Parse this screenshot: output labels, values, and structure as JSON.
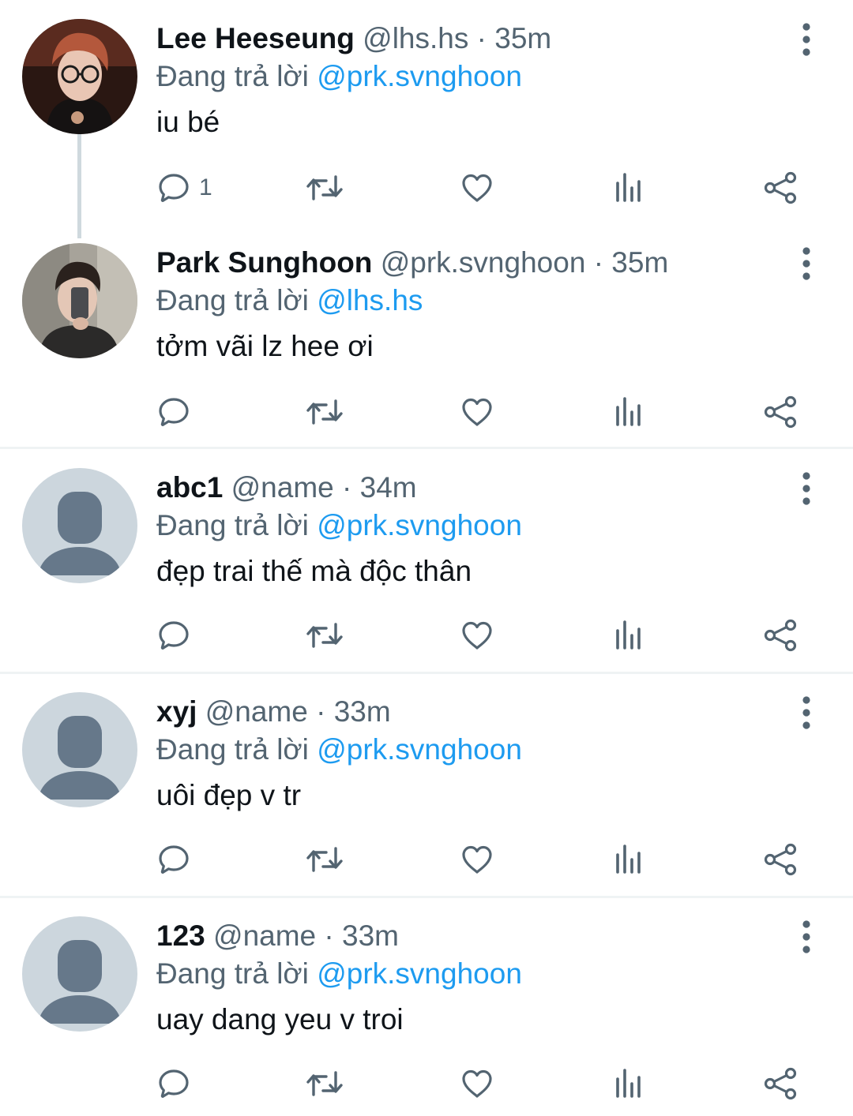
{
  "reply_prefix": "Đang trả lời",
  "colors": {
    "text": "#0f1419",
    "secondary": "#536471",
    "link": "#1d9bf0",
    "divider": "#eff3f4",
    "thread_line": "#cfd9de",
    "default_avatar_bg": "#ccd6dd",
    "default_avatar_fg": "#66788a"
  },
  "icons": {
    "reply": "speech-bubble-icon",
    "retweet": "retweet-icon",
    "like": "heart-icon",
    "views": "bar-chart-icon",
    "share": "share-icon",
    "more": "three-dots-vertical-icon"
  },
  "tweets": [
    {
      "name": "Lee Heeseung",
      "handle": "@lhs.hs",
      "time": "· 35m",
      "reply_to": "@prk.svnghoon",
      "text": "iu bé",
      "reply_count": "1",
      "avatar": "photo-lee-heeseung"
    },
    {
      "name": "Park Sunghoon",
      "handle": "@prk.svnghoon",
      "time": "· 35m",
      "reply_to": "@lhs.hs",
      "text": "tởm vãi lz hee ơi",
      "reply_count": "",
      "avatar": "photo-park-sunghoon"
    },
    {
      "name": "abc1",
      "handle": "@name",
      "time": "· 34m",
      "reply_to": "@prk.svnghoon",
      "text": "đẹp trai thế mà độc thân",
      "reply_count": "",
      "avatar": "default"
    },
    {
      "name": "xyj",
      "handle": "@name",
      "time": "· 33m",
      "reply_to": "@prk.svnghoon",
      "text": "uôi đẹp v tr",
      "reply_count": "",
      "avatar": "default"
    },
    {
      "name": "123",
      "handle": "@name",
      "time": "· 33m",
      "reply_to": "@prk.svnghoon",
      "text": "uay dang yeu v troi",
      "reply_count": "",
      "avatar": "default"
    }
  ]
}
